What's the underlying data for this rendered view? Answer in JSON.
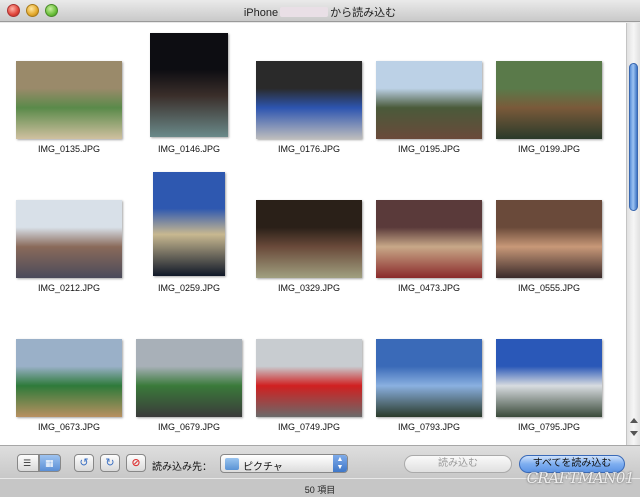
{
  "window": {
    "title_prefix": "iPhone",
    "title_suffix": "から読み込む"
  },
  "photos": [
    {
      "name": "IMG_0135.JPG",
      "colors": [
        "#9a8a6a",
        "#5a8a4a",
        "#d0c0a0"
      ]
    },
    {
      "name": "IMG_0146.JPG",
      "colors": [
        "#0d0d12",
        "#3a2e2a",
        "#6a8a8a"
      ]
    },
    {
      "name": "IMG_0176.JPG",
      "colors": [
        "#2a2a2a",
        "#2d55b0",
        "#bdbdbd"
      ]
    },
    {
      "name": "IMG_0195.JPG",
      "colors": [
        "#bcd1e6",
        "#4a5a3a",
        "#6a4a3a"
      ]
    },
    {
      "name": "IMG_0199.JPG",
      "colors": [
        "#5a7a4a",
        "#7a5a3a",
        "#2a3a2a"
      ]
    },
    {
      "name": "IMG_0212.JPG",
      "colors": [
        "#d8e0e8",
        "#8a6a5a",
        "#4a4a5a"
      ]
    },
    {
      "name": "IMG_0259.JPG",
      "colors": [
        "#2e58b0",
        "#c8b890",
        "#101828"
      ]
    },
    {
      "name": "IMG_0329.JPG",
      "colors": [
        "#2a2018",
        "#6a4a3a",
        "#a0a080"
      ]
    },
    {
      "name": "IMG_0473.JPG",
      "colors": [
        "#5a3a3a",
        "#c8a888",
        "#8a2a2a"
      ]
    },
    {
      "name": "IMG_0555.JPG",
      "colors": [
        "#6a4a3a",
        "#c89878",
        "#3a2a2a"
      ]
    },
    {
      "name": "IMG_0673.JPG",
      "colors": [
        "#9ab0c8",
        "#2e7a3a",
        "#b89060"
      ]
    },
    {
      "name": "IMG_0679.JPG",
      "colors": [
        "#a8b0b8",
        "#3a7a3a",
        "#3a3a3a"
      ]
    },
    {
      "name": "IMG_0749.JPG",
      "colors": [
        "#c8ccd0",
        "#d02020",
        "#6a6a6a"
      ]
    },
    {
      "name": "IMG_0793.JPG",
      "colors": [
        "#3a6ab8",
        "#8ab0e0",
        "#2a3a2a"
      ]
    },
    {
      "name": "IMG_0795.JPG",
      "colors": [
        "#2a58b8",
        "#d8dce0",
        "#3a4a3a"
      ]
    }
  ],
  "toolbar": {
    "import_to_label": "読み込み先：",
    "destination": "ピクチャ",
    "import_button": "読み込む",
    "import_all_button": "すべてを読み込む"
  },
  "status": {
    "item_count": "50 項目"
  },
  "watermark": "CRAFTMAN01"
}
